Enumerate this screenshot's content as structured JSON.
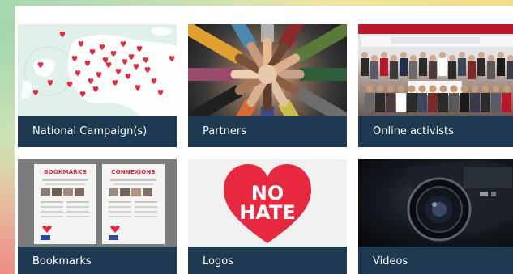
{
  "cards": [
    {
      "label": "National Campaign(s)",
      "image": "europe-map-hearts"
    },
    {
      "label": "Partners",
      "image": "joined-hands"
    },
    {
      "label": "Online activists",
      "image": "group-photo"
    },
    {
      "label": "Bookmarks",
      "image": "bookmark-leaflets"
    },
    {
      "label": "Logos",
      "image": "no-hate-heart-logo"
    },
    {
      "label": "Videos",
      "image": "video-camera"
    }
  ],
  "bookmarks": {
    "left_title": "BOOKMARKS",
    "right_title": "CONNEXIONS"
  },
  "logo": {
    "line1": "NO",
    "line2": "HATE",
    "heart_color": "#e8283f"
  },
  "colors": {
    "label_bar": "#1d3a52",
    "label_text": "#ffffff",
    "map_background": "#dff1ea",
    "map_hearts": "#e8283f"
  }
}
